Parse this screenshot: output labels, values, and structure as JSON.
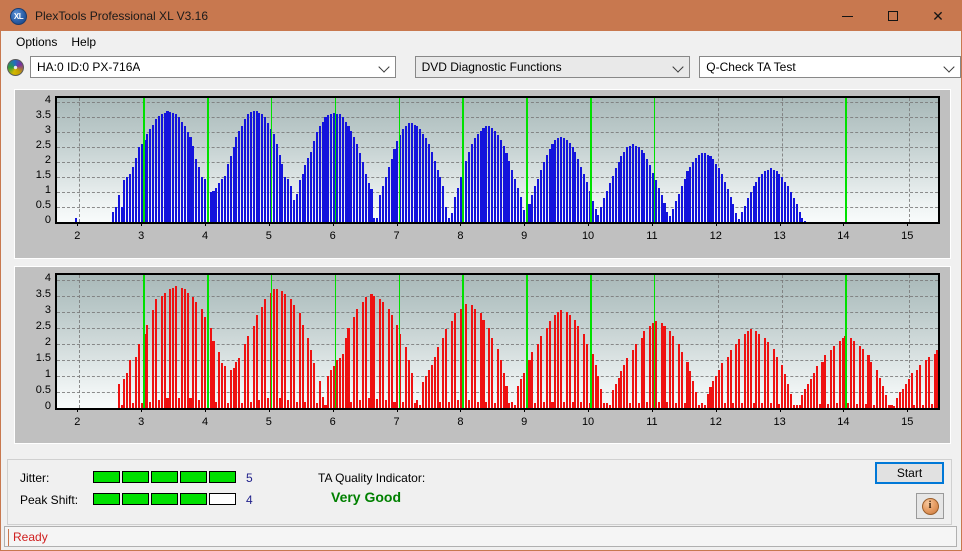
{
  "window": {
    "title": "PlexTools Professional XL V3.16",
    "app_icon": "XL",
    "minimize": "–",
    "maximize": "□",
    "close": "✕"
  },
  "menu": {
    "items": [
      {
        "label": "Options"
      },
      {
        "label": "Help"
      }
    ]
  },
  "toolbar": {
    "drive_icon": "disc-icon",
    "drive_value": "HA:0 ID:0  PX-716A",
    "function_value": "DVD Diagnostic Functions",
    "test_value": "Q-Check TA Test"
  },
  "results": {
    "jitter_label": "Jitter:",
    "jitter_value": "5",
    "jitter_filled": 5,
    "jitter_total": 5,
    "peakshift_label": "Peak Shift:",
    "peakshift_value": "4",
    "peakshift_filled": 4,
    "peakshift_total": 5,
    "ta_quality_label": "TA Quality Indicator:",
    "ta_quality_value": "Very Good",
    "ta_quality_color": "#008000",
    "start_label": "Start",
    "info_label": "i"
  },
  "statusbar": {
    "text": "Ready",
    "color": "#d02020"
  },
  "chart_data": [
    {
      "id": "top",
      "type": "bar",
      "title": "",
      "series_name": "Jitter",
      "color": "#1414dc",
      "marker_color": "#00e000",
      "xlabel": "",
      "ylabel": "",
      "xlim": [
        1.65,
        15.45
      ],
      "ylim": [
        0,
        4.15
      ],
      "grid": true,
      "yticks": [
        0,
        0.5,
        1,
        1.5,
        2,
        2.5,
        3,
        3.5,
        4
      ],
      "ytick_labels": [
        "0",
        "0.5",
        "1",
        "1.5",
        "2",
        "2.5",
        "3",
        "3.5",
        "4"
      ],
      "xticks": [
        2,
        3,
        4,
        5,
        6,
        7,
        8,
        9,
        10,
        11,
        12,
        13,
        14,
        15
      ],
      "xtick_labels": [
        "2",
        "3",
        "4",
        "5",
        "6",
        "7",
        "8",
        "9",
        "10",
        "11",
        "12",
        "13",
        "14",
        "15"
      ],
      "gridlines_v": [
        2,
        4,
        6,
        8,
        10,
        12,
        13,
        15
      ],
      "markers_v": [
        3,
        4,
        5,
        6,
        7,
        8,
        9,
        10,
        11,
        14
      ],
      "bar_step": 0.045,
      "x_start": 1.7,
      "values": [
        0,
        0,
        0,
        0,
        0,
        0.12,
        0,
        0,
        0,
        0,
        0,
        0,
        0,
        0,
        0,
        0,
        0,
        0,
        0.35,
        0.5,
        0.9,
        0.5,
        1.4,
        1.5,
        1.6,
        1.85,
        2.15,
        2.5,
        2.6,
        2.75,
        2.95,
        3.1,
        3.25,
        3.45,
        3.55,
        3.6,
        3.65,
        3.7,
        3.68,
        3.65,
        3.62,
        3.5,
        3.35,
        3.2,
        3.0,
        2.85,
        2.55,
        2.1,
        1.85,
        1.5,
        1.45,
        1.1,
        1.0,
        1.05,
        1.15,
        1.3,
        1.45,
        1.55,
        1.95,
        2.2,
        2.5,
        2.85,
        3.05,
        3.2,
        3.45,
        3.6,
        3.68,
        3.72,
        3.7,
        3.66,
        3.6,
        3.5,
        3.3,
        3.1,
        2.95,
        2.6,
        2.25,
        1.95,
        1.5,
        1.45,
        1.2,
        0.75,
        0.95,
        1.4,
        1.6,
        1.9,
        2.15,
        2.35,
        2.7,
        3.0,
        3.2,
        3.35,
        3.5,
        3.58,
        3.62,
        3.65,
        3.63,
        3.6,
        3.5,
        3.35,
        3.2,
        3.05,
        2.85,
        2.6,
        2.3,
        2.0,
        1.6,
        1.3,
        1.1,
        0.15,
        0.15,
        0.9,
        1.2,
        1.5,
        1.85,
        2.1,
        2.45,
        2.7,
        2.9,
        3.1,
        3.2,
        3.3,
        3.3,
        3.25,
        3.2,
        3.1,
        2.95,
        2.8,
        2.6,
        2.35,
        2.05,
        1.75,
        1.5,
        1.2,
        0.5,
        0.15,
        0.3,
        0.85,
        1.15,
        1.5,
        1.8,
        2.05,
        2.35,
        2.6,
        2.8,
        2.95,
        3.05,
        3.15,
        3.2,
        3.2,
        3.15,
        3.05,
        2.9,
        2.75,
        2.55,
        2.3,
        2.05,
        1.75,
        1.45,
        1.15,
        0.85,
        0.4,
        0.2,
        0.6,
        0.9,
        1.2,
        1.45,
        1.75,
        2.0,
        2.25,
        2.45,
        2.6,
        2.75,
        2.8,
        2.85,
        2.8,
        2.75,
        2.65,
        2.5,
        2.35,
        2.1,
        1.85,
        1.6,
        1.35,
        1.05,
        0.7,
        0.45,
        0.25,
        0.5,
        0.8,
        1.05,
        1.3,
        1.55,
        1.8,
        2.0,
        2.2,
        2.35,
        2.5,
        2.55,
        2.6,
        2.55,
        2.5,
        2.4,
        2.3,
        2.1,
        1.9,
        1.65,
        1.4,
        1.15,
        0.9,
        0.65,
        0.35,
        0.2,
        0.45,
        0.7,
        0.95,
        1.2,
        1.45,
        1.7,
        1.85,
        2.0,
        2.15,
        2.25,
        2.3,
        2.3,
        2.25,
        2.2,
        2.1,
        1.95,
        1.8,
        1.6,
        1.35,
        1.1,
        0.85,
        0.6,
        0.3,
        0.1,
        0.35,
        0.55,
        0.8,
        1.0,
        1.2,
        1.35,
        1.5,
        1.6,
        1.7,
        1.75,
        1.8,
        1.75,
        1.7,
        1.6,
        1.5,
        1.35,
        1.2,
        1.0,
        0.8,
        0.6,
        0.35,
        0.15,
        0.05,
        0,
        0,
        0,
        0,
        0,
        0,
        0,
        0,
        0,
        0,
        0,
        0,
        0,
        0,
        0,
        0,
        0,
        0,
        0,
        0,
        0,
        0,
        0,
        0,
        0,
        0,
        0,
        0,
        0,
        0,
        0,
        0,
        0,
        0,
        0,
        0,
        0,
        0,
        0,
        0,
        0,
        0,
        0,
        0,
        0,
        0,
        0,
        0,
        0,
        0,
        0,
        0,
        0,
        0,
        0,
        0,
        0,
        0.3,
        0.55,
        0.85,
        1.15,
        1.45,
        1.7,
        1.9,
        2.05,
        2.15,
        2.2,
        2.15,
        2.05,
        1.85,
        1.5,
        1.2,
        0.85,
        0.5,
        0.2,
        0,
        0,
        0,
        0,
        0,
        0,
        0,
        0,
        0,
        0,
        0,
        0,
        0,
        0,
        0,
        0,
        0,
        0,
        0,
        0,
        0,
        0,
        0,
        0,
        0,
        0,
        0,
        0,
        0
      ]
    },
    {
      "id": "bottom",
      "type": "bar",
      "title": "",
      "series_name": "Peak Shift",
      "color": "#ee1111",
      "marker_color": "#00e000",
      "xlabel": "",
      "ylabel": "",
      "xlim": [
        1.65,
        15.45
      ],
      "ylim": [
        0,
        4.15
      ],
      "grid": true,
      "yticks": [
        0,
        0.5,
        1,
        1.5,
        2,
        2.5,
        3,
        3.5,
        4
      ],
      "ytick_labels": [
        "0",
        "0.5",
        "1",
        "1.5",
        "2",
        "2.5",
        "3",
        "3.5",
        "4"
      ],
      "xticks": [
        2,
        3,
        4,
        5,
        6,
        7,
        8,
        9,
        10,
        11,
        12,
        13,
        14,
        15
      ],
      "xtick_labels": [
        "2",
        "3",
        "4",
        "5",
        "6",
        "7",
        "8",
        "9",
        "10",
        "11",
        "12",
        "13",
        "14",
        "15"
      ],
      "gridlines_v": [
        2,
        4,
        6,
        8,
        10,
        12,
        13,
        15
      ],
      "markers_v": [
        3,
        4,
        5,
        6,
        7,
        8,
        9,
        10,
        11,
        14
      ],
      "bar_step": 0.045,
      "x_start": 1.7,
      "values": [
        0,
        0,
        0,
        0,
        0,
        0,
        0,
        0,
        0,
        0,
        0,
        0,
        0,
        0,
        0,
        0,
        0,
        0,
        0,
        0,
        0.75,
        0.1,
        0.9,
        1.1,
        1.5,
        0.15,
        1.6,
        2.0,
        0.15,
        2.3,
        2.6,
        0.2,
        3.05,
        3.4,
        0.25,
        3.5,
        3.6,
        0.3,
        3.7,
        3.75,
        3.8,
        0.3,
        3.75,
        3.7,
        3.6,
        0.3,
        3.45,
        3.3,
        0.25,
        3.1,
        2.85,
        0.2,
        2.5,
        2.1,
        0.2,
        1.75,
        1.4,
        1.3,
        0.15,
        1.2,
        1.25,
        1.45,
        1.55,
        0.15,
        2.0,
        2.25,
        0.2,
        2.55,
        2.9,
        0.25,
        3.15,
        3.4,
        0.3,
        3.6,
        3.7,
        3.72,
        0.3,
        3.65,
        3.55,
        0.25,
        3.4,
        3.2,
        0.2,
        2.95,
        2.6,
        0.2,
        2.2,
        1.8,
        1.4,
        0.15,
        0.85,
        0.35,
        0.1,
        1.0,
        1.2,
        1.3,
        1.5,
        1.55,
        1.7,
        2.2,
        2.5,
        0.2,
        2.85,
        3.1,
        0.25,
        3.3,
        3.45,
        0.3,
        3.55,
        3.5,
        0.28,
        3.4,
        3.3,
        0.25,
        3.1,
        2.9,
        0.2,
        2.6,
        2.3,
        0.2,
        1.9,
        1.5,
        1.1,
        0.15,
        0.25,
        0.1,
        0.8,
        1.0,
        1.2,
        1.35,
        1.6,
        1.9,
        0.2,
        2.2,
        2.45,
        0.2,
        2.7,
        2.95,
        0.25,
        3.1,
        3.2,
        3.25,
        0.25,
        3.2,
        3.1,
        0.2,
        2.95,
        2.75,
        0.2,
        2.5,
        2.2,
        0.15,
        1.85,
        1.5,
        1.1,
        0.7,
        0.15,
        0.2,
        0.1,
        0.7,
        0.9,
        1.1,
        1.3,
        1.5,
        1.75,
        0.15,
        2.0,
        2.25,
        0.2,
        2.5,
        2.7,
        0.2,
        2.9,
        3.0,
        3.05,
        0.2,
        3.0,
        2.9,
        0.2,
        2.75,
        2.55,
        0.2,
        2.3,
        2.0,
        0.15,
        1.7,
        1.35,
        1.0,
        0.6,
        0.15,
        0.15,
        0.1,
        0.55,
        0.75,
        0.95,
        1.15,
        1.35,
        1.55,
        0.15,
        1.8,
        2.0,
        0.15,
        2.2,
        2.4,
        0.2,
        2.55,
        2.65,
        2.7,
        0.2,
        2.65,
        2.55,
        0.18,
        2.4,
        2.25,
        0.15,
        2.0,
        1.75,
        0.15,
        1.45,
        1.15,
        0.85,
        0.5,
        0.1,
        0.15,
        0.1,
        0.45,
        0.65,
        0.85,
        1.0,
        1.2,
        1.4,
        0.15,
        1.6,
        1.8,
        0.15,
        2.0,
        2.15,
        0.15,
        2.3,
        2.4,
        2.45,
        0.15,
        2.4,
        2.3,
        0.15,
        2.2,
        2.05,
        0.15,
        1.85,
        1.6,
        0.12,
        1.35,
        1.05,
        0.75,
        0.45,
        0.1,
        0.1,
        0.08,
        0.4,
        0.6,
        0.75,
        0.9,
        1.1,
        1.3,
        0.12,
        1.45,
        1.65,
        0.12,
        1.8,
        1.95,
        0.15,
        2.1,
        2.2,
        2.25,
        0.15,
        2.2,
        2.1,
        0.12,
        1.95,
        1.85,
        0.12,
        1.65,
        1.45,
        0.1,
        1.2,
        0.95,
        0.7,
        0.4,
        0.08,
        0.1,
        0.05,
        0.3,
        0.5,
        0.6,
        0.75,
        0.9,
        1.1,
        0.1,
        1.2,
        1.35,
        0.1,
        1.5,
        1.6,
        0.12,
        1.7,
        1.8,
        1.85,
        0.12,
        1.8,
        1.7,
        0.1,
        1.6,
        1.5,
        0.1,
        1.3,
        1.1,
        0.1,
        0.9,
        0.65,
        0.45,
        0.2,
        0.05,
        0.2,
        0,
        0,
        0,
        0,
        0,
        0,
        0,
        0,
        0,
        0,
        0,
        0,
        0,
        0,
        0,
        0,
        0,
        0,
        0,
        0,
        0,
        0,
        0,
        0,
        0,
        0,
        0,
        0,
        0,
        0,
        0,
        0,
        0,
        0,
        0,
        0,
        0,
        0,
        0,
        0,
        0,
        0,
        0,
        0,
        0,
        0,
        0,
        0,
        0,
        0,
        0,
        0,
        0.15,
        0.2,
        0.1,
        0.45,
        0.7,
        0.95,
        1.15,
        0.12,
        1.3,
        1.35,
        0.15,
        1.25,
        1.1,
        0.15,
        0.95,
        0.75,
        0.55,
        0.3,
        0.15,
        0.05,
        0,
        0,
        0,
        0,
        0,
        0,
        0,
        0,
        0,
        0,
        0,
        0,
        0,
        0,
        0,
        0,
        0,
        0,
        0,
        0,
        0,
        0,
        0,
        0,
        0,
        0,
        0
      ]
    }
  ]
}
